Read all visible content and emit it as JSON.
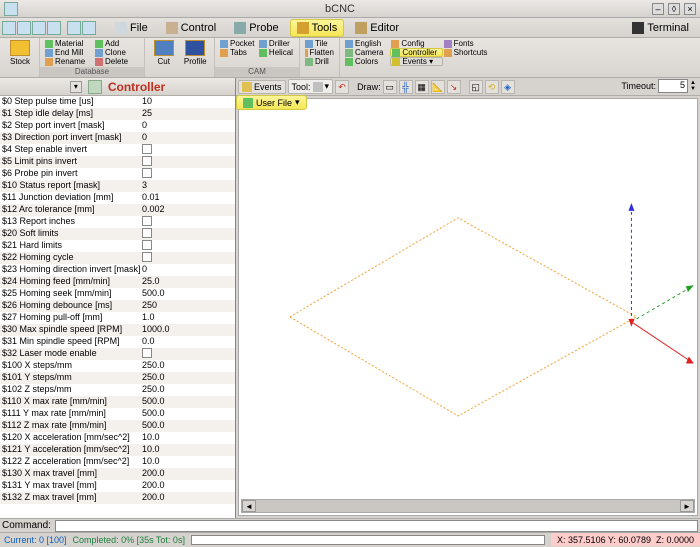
{
  "window": {
    "title": "bCNC"
  },
  "menubar": {
    "file": "File",
    "control": "Control",
    "probe": "Probe",
    "tools": "Tools",
    "editor": "Editor",
    "terminal": "Terminal"
  },
  "ribbon": {
    "database_label": "Database",
    "cam_label": "CAM",
    "stock": "Stock",
    "material": "Material",
    "endmill": "End Mill",
    "rename": "Rename",
    "add": "Add",
    "clone": "Clone",
    "delete": "Delete",
    "cut": "Cut",
    "profile": "Profile",
    "pocket": "Pocket",
    "tabs": "Tabs",
    "driller": "Driller",
    "helical": "Helical",
    "tile": "Tile",
    "flatten": "Flatten",
    "drill": "Drill",
    "english": "English",
    "camera": "Camera",
    "colors": "Colors",
    "config": "Config",
    "controller": "Controller",
    "fonts": "Fonts",
    "shortcuts": "Shortcuts",
    "events_dd": "Events ▾"
  },
  "controller": {
    "title": "Controller"
  },
  "params": [
    {
      "name": "$0 Step pulse time [us]",
      "val": "10"
    },
    {
      "name": "$1 Step idle delay [ms]",
      "val": "25"
    },
    {
      "name": "$2 Step port invert [mask]",
      "val": "0"
    },
    {
      "name": "$3 Direction port invert [mask]",
      "val": "0"
    },
    {
      "name": "$4 Step enable invert",
      "val": "chk"
    },
    {
      "name": "$5 Limit pins invert",
      "val": "chk"
    },
    {
      "name": "$6 Probe pin invert",
      "val": "chk"
    },
    {
      "name": "$10 Status report [mask]",
      "val": "3"
    },
    {
      "name": "$11 Junction deviation [mm]",
      "val": "0.01"
    },
    {
      "name": "$12 Arc tolerance [mm]",
      "val": "0.002"
    },
    {
      "name": "$13 Report inches",
      "val": "chk"
    },
    {
      "name": "$20 Soft limits",
      "val": "chk"
    },
    {
      "name": "$21 Hard limits",
      "val": "chk"
    },
    {
      "name": "$22 Homing cycle",
      "val": "chk"
    },
    {
      "name": "$23 Homing direction invert [mask]",
      "val": "0"
    },
    {
      "name": "$24 Homing feed [mm/min]",
      "val": "25.0"
    },
    {
      "name": "$25 Homing seek [mm/min]",
      "val": "500.0"
    },
    {
      "name": "$26 Homing debounce [ms]",
      "val": "250"
    },
    {
      "name": "$27 Homing pull-off [mm]",
      "val": "1.0"
    },
    {
      "name": "$30 Max spindle speed [RPM]",
      "val": "1000.0"
    },
    {
      "name": "$31 Min spindle speed [RPM]",
      "val": "0.0"
    },
    {
      "name": "$32 Laser mode enable",
      "val": "chk"
    },
    {
      "name": "$100 X steps/mm",
      "val": "250.0"
    },
    {
      "name": "$101 Y steps/mm",
      "val": "250.0"
    },
    {
      "name": "$102 Z steps/mm",
      "val": "250.0"
    },
    {
      "name": "$110 X max rate [mm/min]",
      "val": "500.0"
    },
    {
      "name": "$111 Y max rate [mm/min]",
      "val": "500.0"
    },
    {
      "name": "$112 Z max rate [mm/min]",
      "val": "500.0"
    },
    {
      "name": "$120 X acceleration [mm/sec^2]",
      "val": "10.0"
    },
    {
      "name": "$121 Y acceleration [mm/sec^2]",
      "val": "10.0"
    },
    {
      "name": "$122 Z acceleration [mm/sec^2]",
      "val": "10.0"
    },
    {
      "name": "$130 X max travel [mm]",
      "val": "200.0"
    },
    {
      "name": "$131 Y max travel [mm]",
      "val": "200.0"
    },
    {
      "name": "$132 Z max travel [mm]",
      "val": "200.0"
    }
  ],
  "canvas_toolbar": {
    "events": "Events",
    "tool": "Tool:",
    "draw": "Draw:",
    "userfile": "User File",
    "timeout_label": "Timeout:",
    "timeout_val": "5"
  },
  "command": {
    "label": "Command:"
  },
  "status": {
    "current": "Current: 0 [100]",
    "completed": "Completed: 0% [35s Tot: 0s]",
    "coords": "X: 357.5106 Y: 60.0789",
    "z": "Z: 0.0000"
  }
}
